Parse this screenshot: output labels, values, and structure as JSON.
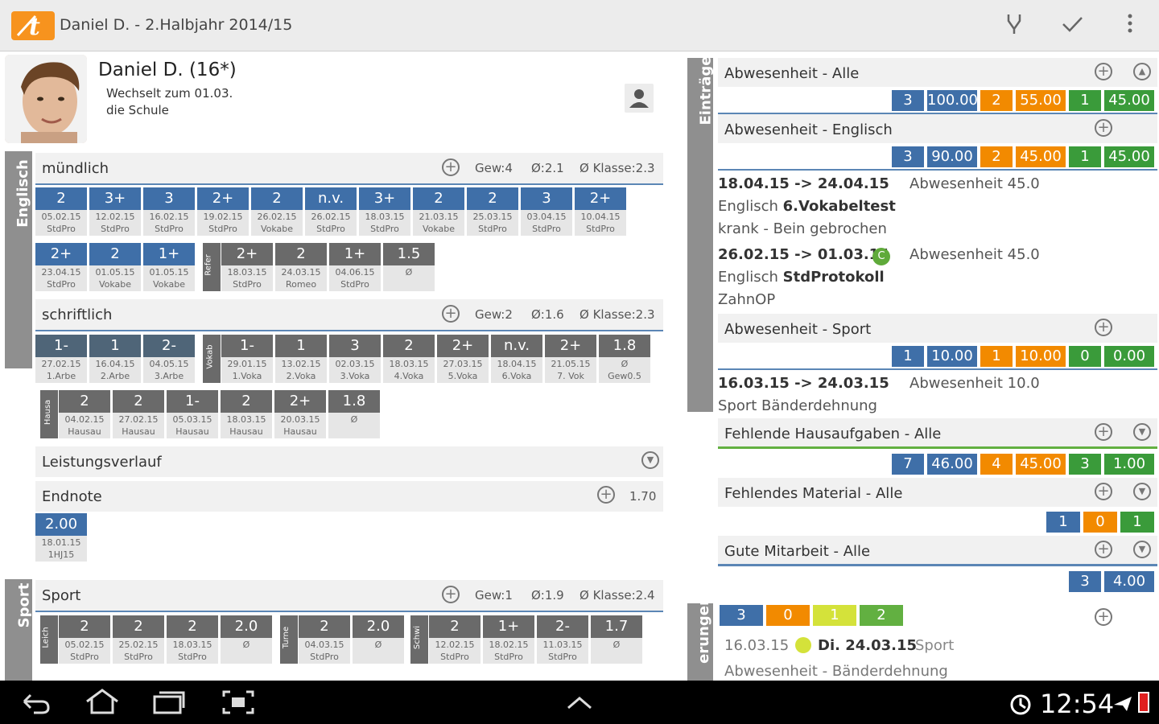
{
  "app": {
    "title": "Daniel D. - 2.Halbjahr 2014/15",
    "icons": [
      "fork-icon",
      "check-icon",
      "overflow-menu-icon"
    ]
  },
  "student": {
    "name": "Daniel D.  (16*)",
    "note_line1": "Wechselt zum 01.03.",
    "note_line2": "die Schule"
  },
  "tabs": {
    "english": "Englisch",
    "sport": "Sport",
    "entries": "Einträge",
    "changes": "erungen"
  },
  "muendlich": {
    "label": "mündlich",
    "gew": "Gew:4",
    "avg": "Ø:2.1",
    "klasse": "Ø Klasse:2.3",
    "row1": [
      {
        "g": "2",
        "d1": "05.02.15",
        "d2": "StdPro"
      },
      {
        "g": "3+",
        "d1": "12.02.15",
        "d2": "StdPro"
      },
      {
        "g": "3",
        "d1": "16.02.15",
        "d2": "StdPro"
      },
      {
        "g": "2+",
        "d1": "19.02.15",
        "d2": "StdPro"
      },
      {
        "g": "2",
        "d1": "26.02.15",
        "d2": "Vokabe"
      },
      {
        "g": "n.v.",
        "d1": "26.02.15",
        "d2": "StdPro"
      },
      {
        "g": "3+",
        "d1": "18.03.15",
        "d2": "StdPro"
      },
      {
        "g": "2",
        "d1": "21.03.15",
        "d2": "Vokabe"
      },
      {
        "g": "2",
        "d1": "25.03.15",
        "d2": "StdPro"
      },
      {
        "g": "3",
        "d1": "03.04.15",
        "d2": "StdPro"
      },
      {
        "g": "2+",
        "d1": "10.04.15",
        "d2": "StdPro"
      }
    ],
    "row2a": [
      {
        "g": "2+",
        "d1": "23.04.15",
        "d2": "StdPro"
      },
      {
        "g": "2",
        "d1": "01.05.15",
        "d2": "Vokabe"
      },
      {
        "g": "1+",
        "d1": "01.05.15",
        "d2": "Vokabe"
      }
    ],
    "row2_label": "Refer",
    "row2b": [
      {
        "g": "2+",
        "d1": "18.03.15",
        "d2": "StdPro"
      },
      {
        "g": "2",
        "d1": "24.03.15",
        "d2": "Romeo"
      },
      {
        "g": "1+",
        "d1": "04.06.15",
        "d2": "StdPro"
      },
      {
        "g": "1.5",
        "d1": "Ø",
        "d2": ""
      }
    ]
  },
  "schriftlich": {
    "label": "schriftlich",
    "gew": "Gew:2",
    "avg": "Ø:1.6",
    "klasse": "Ø Klasse:2.3",
    "row1a": [
      {
        "g": "1-",
        "d1": "27.02.15",
        "d2": "1.Arbe"
      },
      {
        "g": "1",
        "d1": "16.04.15",
        "d2": "2.Arbe"
      },
      {
        "g": "2-",
        "d1": "04.05.15",
        "d2": "3.Arbe"
      }
    ],
    "row1_label": "Vokab",
    "row1b": [
      {
        "g": "1-",
        "d1": "29.01.15",
        "d2": "1.Voka"
      },
      {
        "g": "1",
        "d1": "13.02.15",
        "d2": "2.Voka"
      },
      {
        "g": "3",
        "d1": "02.03.15",
        "d2": "3.Voka"
      },
      {
        "g": "2",
        "d1": "18.03.15",
        "d2": "4.Voka"
      },
      {
        "g": "2+",
        "d1": "27.03.15",
        "d2": "5.Voka"
      },
      {
        "g": "n.v.",
        "d1": "18.04.15",
        "d2": "6.Voka"
      },
      {
        "g": "2+",
        "d1": "21.05.15",
        "d2": "7. Vok"
      },
      {
        "g": "1.8",
        "d1": "Ø",
        "d2": "Gew0.5"
      }
    ],
    "row2_label": "Hausa",
    "row2": [
      {
        "g": "2",
        "d1": "04.02.15",
        "d2": "Hausau"
      },
      {
        "g": "2",
        "d1": "27.02.15",
        "d2": "Hausau"
      },
      {
        "g": "1-",
        "d1": "05.03.15",
        "d2": "Hausau"
      },
      {
        "g": "2",
        "d1": "18.03.15",
        "d2": "Hausau"
      },
      {
        "g": "2+",
        "d1": "20.03.15",
        "d2": "Hausau"
      },
      {
        "g": "1.8",
        "d1": "Ø",
        "d2": ""
      }
    ]
  },
  "leistungsverlauf": {
    "label": "Leistungsverlauf"
  },
  "endnote": {
    "label": "Endnote",
    "value": "1.70",
    "grade": {
      "g": "2.00",
      "d1": "18.01.15",
      "d2": "1HJ15"
    }
  },
  "sport": {
    "label": "Sport",
    "gew": "Gew:1",
    "avg": "Ø:1.9",
    "klasse": "Ø Klasse:2.4",
    "g1_label": "Leich",
    "g1": [
      {
        "g": "2",
        "d1": "05.02.15",
        "d2": "StdPro"
      },
      {
        "g": "2",
        "d1": "25.02.15",
        "d2": "StdPro"
      },
      {
        "g": "2",
        "d1": "18.03.15",
        "d2": "StdPro"
      },
      {
        "g": "2.0",
        "d1": "Ø",
        "d2": ""
      }
    ],
    "g2_label": "Turne",
    "g2": [
      {
        "g": "2",
        "d1": "04.03.15",
        "d2": "StdPro"
      },
      {
        "g": "2.0",
        "d1": "Ø",
        "d2": ""
      }
    ],
    "g3_label": "Schwi",
    "g3": [
      {
        "g": "2",
        "d1": "12.02.15",
        "d2": "StdPro"
      },
      {
        "g": "1+",
        "d1": "18.02.15",
        "d2": "StdPro"
      },
      {
        "g": "2-",
        "d1": "11.03.15",
        "d2": "StdPro"
      },
      {
        "g": "1.7",
        "d1": "Ø",
        "d2": ""
      }
    ]
  },
  "entries": {
    "abw_alle": {
      "label": "Abwesenheit - Alle",
      "v": [
        "3",
        "100.00",
        "2",
        "55.00",
        "1",
        "45.00"
      ]
    },
    "abw_englisch": {
      "label": "Abwesenheit - Englisch",
      "v": [
        "3",
        "90.00",
        "2",
        "45.00",
        "1",
        "45.00"
      ]
    },
    "e1": {
      "date": "18.04.15 -> 24.04.15",
      "type": "Abwesenheit 45.0",
      "subj": "Englisch",
      "subj_b": "6.Vokabeltest",
      "note": "krank - Bein gebrochen"
    },
    "e2": {
      "date": "26.02.15 -> 01.03.14",
      "type": "Abwesenheit 45.0",
      "subj": "Englisch",
      "subj_b": "StdProtokoll",
      "note": "ZahnOP"
    },
    "abw_sport": {
      "label": "Abwesenheit - Sport",
      "v": [
        "1",
        "10.00",
        "1",
        "10.00",
        "0",
        "0.00"
      ]
    },
    "e3": {
      "date": "16.03.15 -> 24.03.15",
      "type": "Abwesenheit 10.0",
      "subj": "Sport Bänderdehnung"
    },
    "hausaufgaben": {
      "label": "Fehlende Hausaufgaben - Alle",
      "v": [
        "7",
        "46.00",
        "4",
        "45.00",
        "3",
        "1.00"
      ]
    },
    "material": {
      "label": "Fehlendes Material - Alle",
      "v": [
        "1",
        "0",
        "1"
      ]
    },
    "mitarbeit": {
      "label": "Gute Mitarbeit - Alle",
      "v": [
        "3",
        "4.00"
      ]
    }
  },
  "changes": {
    "counts": [
      "3",
      "0",
      "1",
      "2"
    ],
    "date": "16.03.15",
    "date_b": "Di. 24.03.15",
    "subj": "Sport",
    "text": "Abwesenheit - Bänderdehnung"
  },
  "system": {
    "clock": "12:54"
  }
}
